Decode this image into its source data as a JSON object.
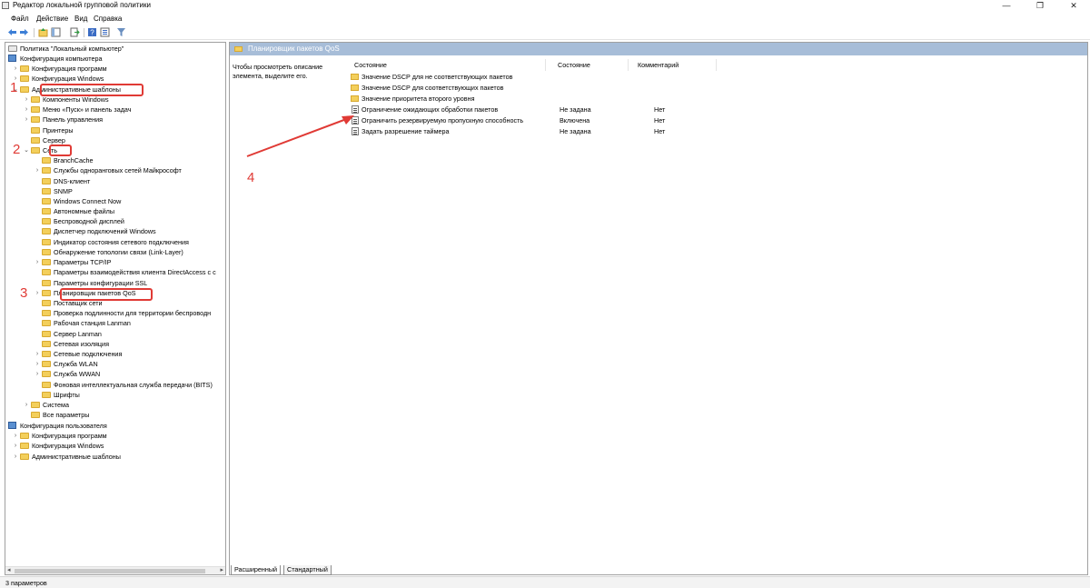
{
  "window": {
    "title": "Редактор локальной групповой политики",
    "minimize_icon": "minimize-icon",
    "restore_icon": "restore-icon",
    "close_icon": "close-icon",
    "min_glyph": "—",
    "restore_glyph": "❐",
    "close_glyph": "✕"
  },
  "menu": [
    "Файл",
    "Действие",
    "Вид",
    "Справка"
  ],
  "toolbar": {
    "icons": [
      "back-arrow-icon",
      "forward-arrow-icon",
      "up-folder-icon",
      "show-hide-tree-icon",
      "export-list-icon",
      "help-icon",
      "properties-icon",
      "filter-icon"
    ]
  },
  "tree": {
    "root": "Политика \"Локальный компьютер\"",
    "items": [
      {
        "label": "Конфигурация компьютера",
        "chev": "⌄"
      },
      {
        "label": "Конфигурация программ",
        "chev": "›"
      },
      {
        "label": "Конфигурация Windows",
        "chev": "›"
      },
      {
        "label": "Административные шаблоны",
        "chev": "⌄"
      },
      {
        "label": "Компоненты Windows",
        "chev": "›"
      },
      {
        "label": "Меню «Пуск» и панель задач",
        "chev": "›"
      },
      {
        "label": "Панель управления",
        "chev": "›"
      },
      {
        "label": "Принтеры",
        "chev": ""
      },
      {
        "label": "Сервер",
        "chev": ""
      },
      {
        "label": "Сеть",
        "chev": "⌄"
      },
      {
        "label": "BranchCache",
        "chev": ""
      },
      {
        "label": "Службы одноранговых сетей Майкрософт",
        "chev": "›"
      },
      {
        "label": "DNS-клиент",
        "chev": ""
      },
      {
        "label": "SNMP",
        "chev": ""
      },
      {
        "label": "Windows Connect Now",
        "chev": ""
      },
      {
        "label": "Автономные файлы",
        "chev": ""
      },
      {
        "label": "Беспроводной дисплей",
        "chev": ""
      },
      {
        "label": "Диспетчер подключений Windows",
        "chev": ""
      },
      {
        "label": "Индикатор состояния сетевого подключения",
        "chev": ""
      },
      {
        "label": "Обнаружение топологии связи (Link-Layer)",
        "chev": ""
      },
      {
        "label": "Параметры TCP/IP",
        "chev": "›"
      },
      {
        "label": "Параметры взаимодействия клиента DirectAccess с с",
        "chev": ""
      },
      {
        "label": "Параметры конфигурации SSL",
        "chev": ""
      },
      {
        "label": "Планировщик пакетов QoS",
        "chev": "›"
      },
      {
        "label": "Поставщик сети",
        "chev": ""
      },
      {
        "label": "Проверка подлинности для территории беспроводн",
        "chev": ""
      },
      {
        "label": "Рабочая станция Lanman",
        "chev": ""
      },
      {
        "label": "Сервер Lanman",
        "chev": ""
      },
      {
        "label": "Сетевая изоляция",
        "chev": ""
      },
      {
        "label": "Сетевые подключения",
        "chev": "›"
      },
      {
        "label": "Служба WLAN",
        "chev": "›"
      },
      {
        "label": "Служба WWAN",
        "chev": "›"
      },
      {
        "label": "Фоновая интеллектуальная служба передачи (BITS)",
        "chev": ""
      },
      {
        "label": "Шрифты",
        "chev": ""
      },
      {
        "label": "Система",
        "chev": "›"
      },
      {
        "label": "Все параметры",
        "chev": ""
      },
      {
        "label": "Конфигурация пользователя",
        "chev": "⌄"
      },
      {
        "label": "Конфигурация программ",
        "chev": "›"
      },
      {
        "label": "Конфигурация Windows",
        "chev": "›"
      },
      {
        "label": "Административные шаблоны",
        "chev": "›"
      }
    ]
  },
  "scroll": {
    "left": "◂",
    "right": "▸"
  },
  "panel": {
    "header": "Планировщик пакетов QoS",
    "description": "Чтобы просмотреть описание элемента, выделите его.",
    "columns": [
      "Состояние",
      "Состояние",
      "Комментарий"
    ],
    "rows": [
      {
        "name": "Значение DSCP для не соответствующих пакетов",
        "state": "",
        "comment": "",
        "type": "folder"
      },
      {
        "name": "Значение DSCP для соответствующих пакетов",
        "state": "",
        "comment": "",
        "type": "folder"
      },
      {
        "name": "Значение приоритета второго уровня",
        "state": "",
        "comment": "",
        "type": "folder"
      },
      {
        "name": "Ограничение ожидающих обработки пакетов",
        "state": "Не задана",
        "comment": "Нет",
        "type": "setting"
      },
      {
        "name": "Ограничить резервируемую пропускную способность",
        "state": "Включена",
        "comment": "Нет",
        "type": "setting"
      },
      {
        "name": "Задать разрешение таймера",
        "state": "Не задана",
        "comment": "Нет",
        "type": "setting"
      }
    ]
  },
  "tabs": [
    "Расширенный",
    "Стандартный"
  ],
  "status": "3 параметров",
  "annotations": {
    "one": "1",
    "two": "2",
    "three": "3",
    "four": "4",
    "color": "#e03a35"
  }
}
